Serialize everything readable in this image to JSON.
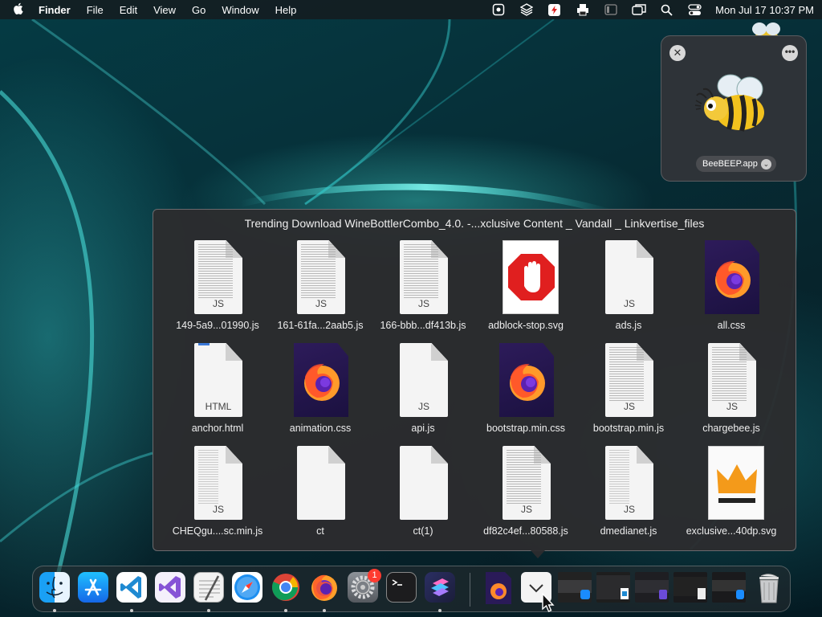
{
  "menubar": {
    "apple": "",
    "app_name": "Finder",
    "items": [
      "File",
      "Edit",
      "View",
      "Go",
      "Window",
      "Help"
    ],
    "status_icons": [
      "screen-record-icon",
      "stack-icon",
      "flash-icon",
      "printer-icon",
      "display-icon",
      "screen-mirroring-icon",
      "spotlight-search-icon",
      "control-center-icon"
    ],
    "clock": "Mon Jul 17  10:37 PM"
  },
  "notification": {
    "close": "✕",
    "more": "•••",
    "app_label": "BeeBEEP.app",
    "chevron": "⌄"
  },
  "stack": {
    "title": "Trending Download WineBottlerCombo_4.0. -...xclusive Content _ Vandall _ Linkvertise_files",
    "files": [
      {
        "name": "149-5a9...01990.js",
        "type": "js-dense",
        "ext": "JS"
      },
      {
        "name": "161-61fa...2aab5.js",
        "type": "js-dense",
        "ext": "JS"
      },
      {
        "name": "166-bbb...df413b.js",
        "type": "js-dense",
        "ext": "JS"
      },
      {
        "name": "adblock-stop.svg",
        "type": "adblock",
        "ext": ""
      },
      {
        "name": "ads.js",
        "type": "js-blank",
        "ext": "JS"
      },
      {
        "name": "all.css",
        "type": "firefox",
        "ext": ""
      },
      {
        "name": "anchor.html",
        "type": "html",
        "ext": "HTML"
      },
      {
        "name": "animation.css",
        "type": "firefox",
        "ext": ""
      },
      {
        "name": "api.js",
        "type": "js-blank",
        "ext": "JS"
      },
      {
        "name": "bootstrap.min.css",
        "type": "firefox",
        "ext": ""
      },
      {
        "name": "bootstrap.min.js",
        "type": "js-dense",
        "ext": "JS"
      },
      {
        "name": "chargebee.js",
        "type": "js-dense",
        "ext": "JS"
      },
      {
        "name": "CHEQgu....sc.min.js",
        "type": "js-sparse",
        "ext": "JS"
      },
      {
        "name": "ct",
        "type": "blank",
        "ext": ""
      },
      {
        "name": "ct(1)",
        "type": "blank",
        "ext": ""
      },
      {
        "name": "df82c4ef...80588.js",
        "type": "js-dense",
        "ext": "JS"
      },
      {
        "name": "dmedianet.js",
        "type": "js-sparse",
        "ext": "JS"
      },
      {
        "name": "exclusive...40dp.svg",
        "type": "crown",
        "ext": ""
      }
    ]
  },
  "dock": {
    "apps": [
      {
        "name": "Finder",
        "icon": "finder-icon",
        "running": true
      },
      {
        "name": "App Store",
        "icon": "app-store-icon",
        "running": false
      },
      {
        "name": "Visual Studio Code",
        "icon": "vscode-icon",
        "running": true
      },
      {
        "name": "Visual Studio",
        "icon": "visual-studio-icon",
        "running": false
      },
      {
        "name": "TextEdit",
        "icon": "textedit-icon",
        "running": true
      },
      {
        "name": "Safari",
        "icon": "safari-icon",
        "running": false
      },
      {
        "name": "Google Chrome",
        "icon": "chrome-icon",
        "running": true
      },
      {
        "name": "Firefox",
        "icon": "firefox-icon",
        "running": true
      },
      {
        "name": "System Preferences",
        "icon": "system-preferences-icon",
        "running": false
      },
      {
        "name": "Terminal",
        "icon": "terminal-icon",
        "running": false
      },
      {
        "name": "Shortcuts",
        "icon": "shortcuts-icon",
        "running": true
      }
    ],
    "badge": "1",
    "stack_item": "Downloads stack",
    "minimized_windows": 5,
    "trash": "Trash"
  },
  "colors": {
    "accent": "#0a84ff",
    "badge": "#ff3b30",
    "wallpaper": "#053b44"
  }
}
